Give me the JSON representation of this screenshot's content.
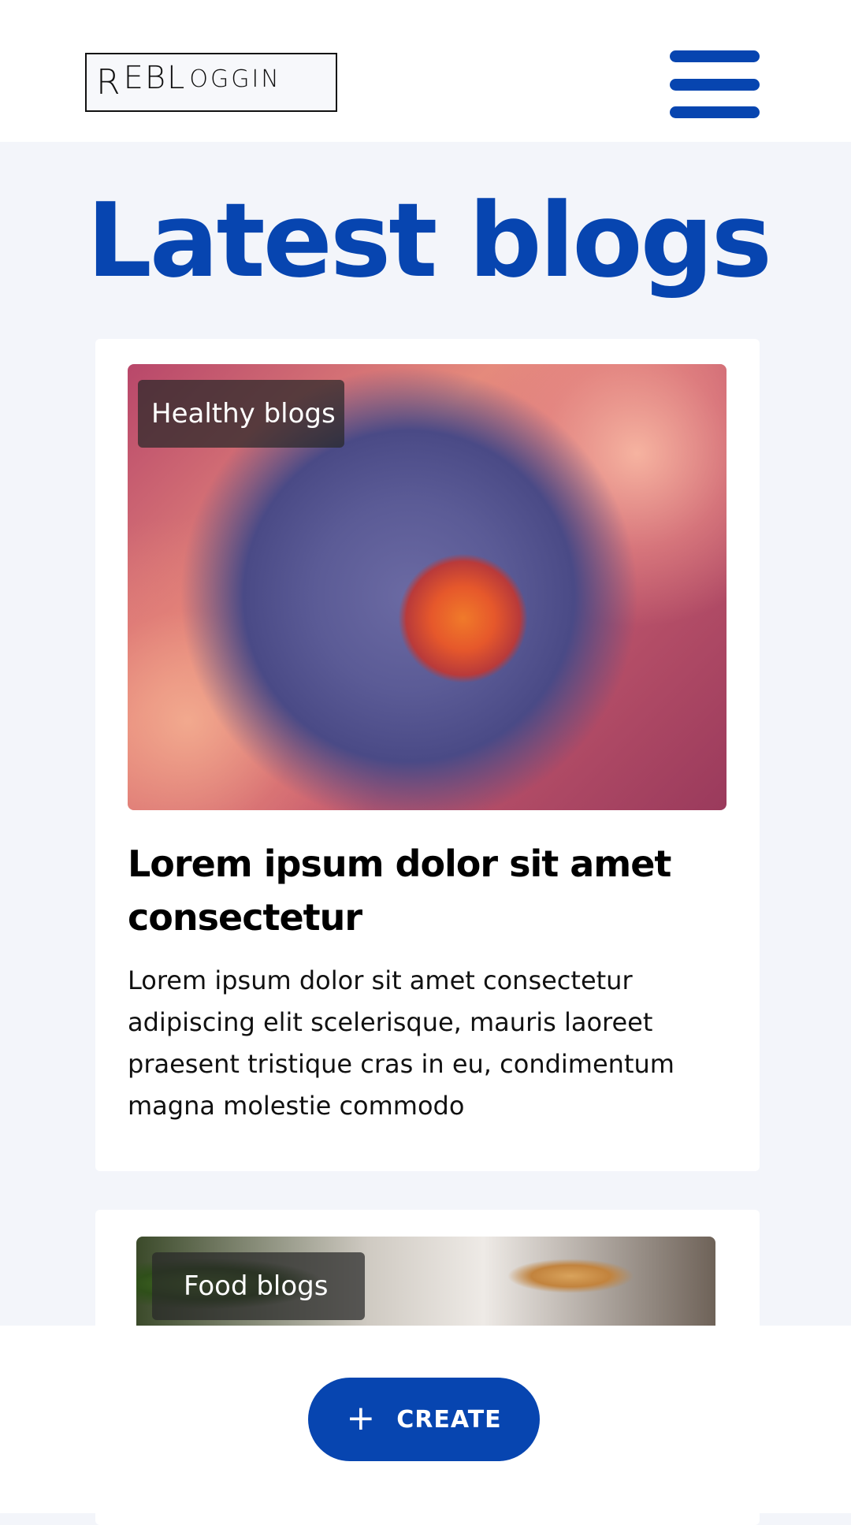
{
  "header": {
    "logo": {
      "letters": [
        "R",
        "EBL",
        "OGGIN"
      ]
    }
  },
  "page": {
    "title": "Latest blogs"
  },
  "posts": [
    {
      "tag": "Healthy blogs",
      "title": "Lorem ipsum dolor sit amet consectetur",
      "excerpt": "Lorem ipsum dolor sit amet consectetur adipiscing elit scelerisque, mauris laoreet praesent tristique cras in eu, condimentum magna molestie commodo",
      "image": "virus-illustration"
    },
    {
      "tag": "Food blogs",
      "image": "breakfast-photo"
    }
  ],
  "actions": {
    "create_label": "CREATE",
    "create_icon": "plus-icon"
  },
  "colors": {
    "brand": "#0745b0",
    "background": "#f3f5fa",
    "card": "#ffffff"
  }
}
